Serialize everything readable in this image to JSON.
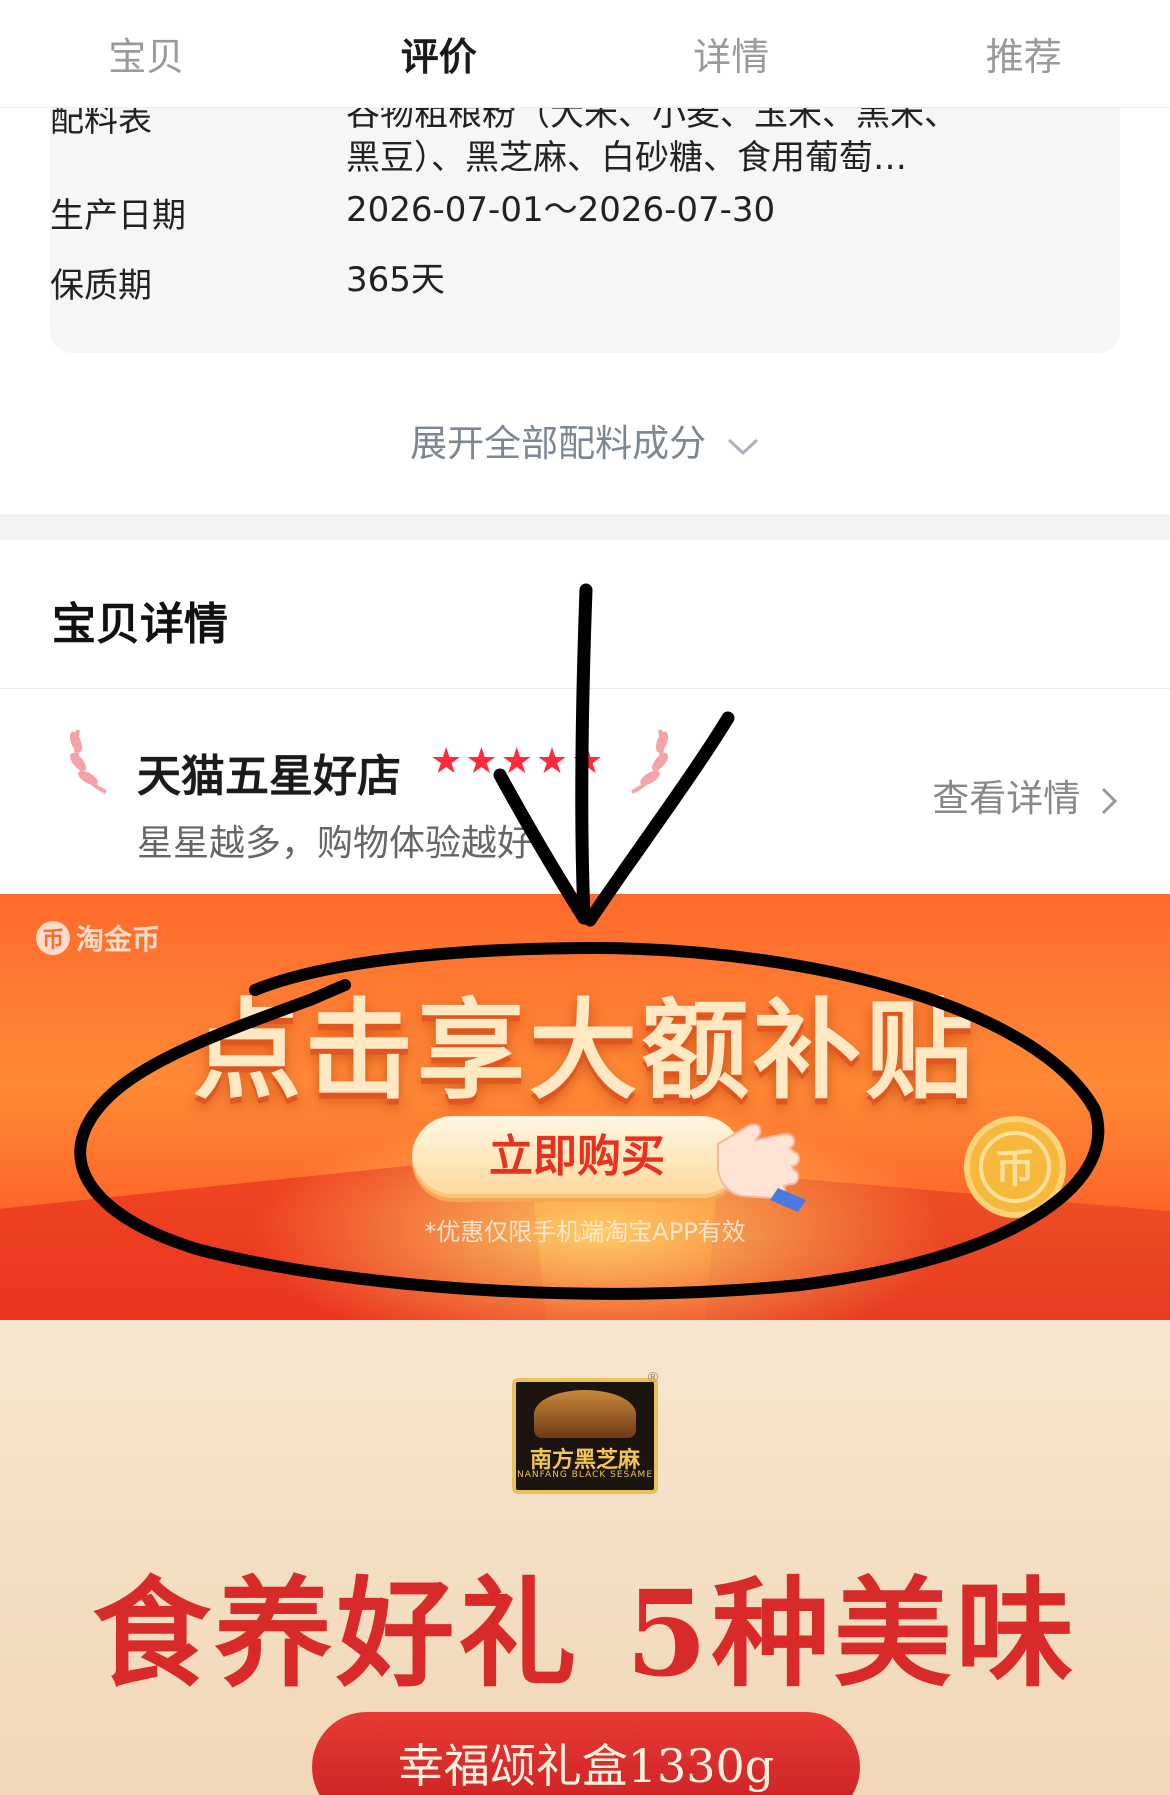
{
  "tabs": [
    {
      "label": "宝贝",
      "active": false
    },
    {
      "label": "评价",
      "active": true
    },
    {
      "label": "详情",
      "active": false
    },
    {
      "label": "推荐",
      "active": false
    }
  ],
  "info": {
    "rows": [
      {
        "key": "配料表",
        "value": "谷物粗粮粉（大米、小麦、玉米、黑米、黑豆）、黑芝麻、白砂糖、食用葡萄…"
      },
      {
        "key": "生产日期",
        "value": "2026-07-01～2026-07-30"
      },
      {
        "key": "保质期",
        "value": "365天"
      }
    ],
    "expand_label": "展开全部配料成分"
  },
  "detail": {
    "title": "宝贝详情"
  },
  "shop": {
    "title": "天猫五星好店",
    "rating_stars": 5,
    "subtitle": "星星越多，购物体验越好",
    "view_detail": "查看详情"
  },
  "promo": {
    "brand": "淘金币",
    "brand_icon": "币",
    "headline": "点击享大额补贴",
    "button": "立即购买",
    "note": "*优惠仅限手机端淘宝APP有效",
    "coin_glyph": "币"
  },
  "product": {
    "logo_text": "南方黑芝麻",
    "logo_sub": "NANFANG BLACK SESAME",
    "registered_mark": "®",
    "headline": "食养好礼 5种美味",
    "pill": "幸福颂礼盒1330g"
  },
  "colors": {
    "accent_red": "#d92a2a",
    "promo_orange": "#ff7a30",
    "annotation_ink": "#000000"
  }
}
